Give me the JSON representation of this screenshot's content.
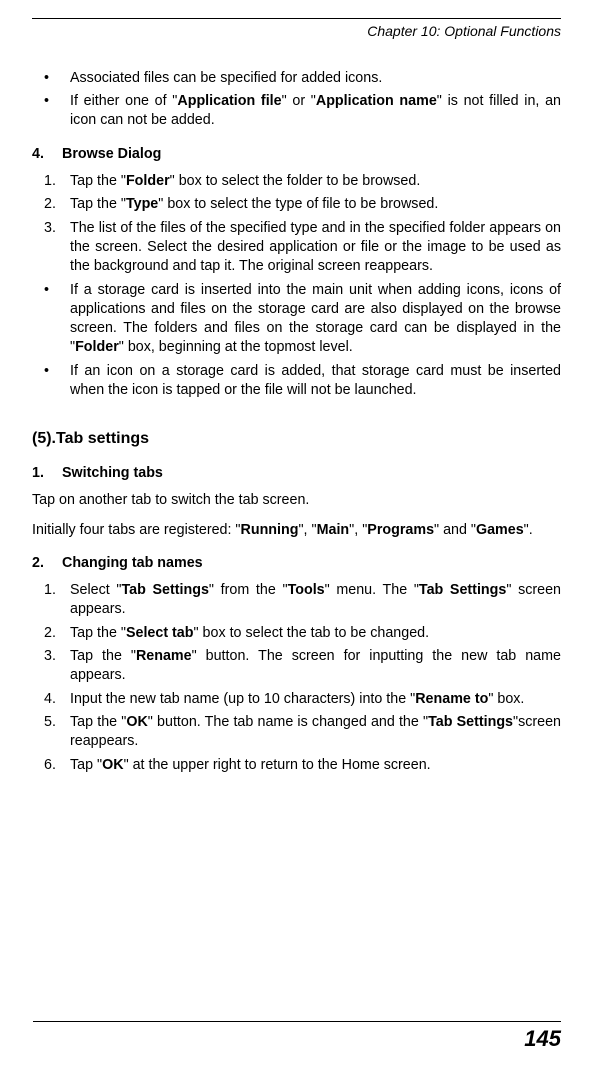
{
  "chapter_header": "Chapter 10: Optional Functions",
  "page_number": "145",
  "top_bullets": [
    {
      "marker": "•",
      "html": "Associated files can be specified for added icons."
    },
    {
      "marker": "•",
      "html": "If either one of \"<b>Application file</b>\" or \"<b>Application name</b>\" is not filled in, an icon can not be added."
    }
  ],
  "browse_heading_num": "4.",
  "browse_heading_label": "Browse Dialog",
  "browse_items": [
    {
      "marker": "1.",
      "html": "Tap the \"<b>Folder</b>\" box to select the folder to be browsed."
    },
    {
      "marker": "2.",
      "html": "Tap the \"<b>Type</b>\" box to select the type of file to be browsed."
    },
    {
      "marker": "3.",
      "html": "The list of the files of the specified type and in the specified folder appears on the screen. Select the desired application or file or the image to be used as the background and tap it. The original screen reappears."
    },
    {
      "marker": "•",
      "html": "If a storage card is inserted into the main unit when adding icons, icons of applications and files on the storage card are also displayed on the browse screen. The folders and files on the storage card can be displayed in the \"<b>Folder</b>\" box, beginning at the topmost level."
    },
    {
      "marker": "•",
      "html": "If an icon on a storage card is added, that storage card must be inserted when the icon is tapped or the file will not be launched."
    }
  ],
  "tab_settings_heading": "(5).Tab settings",
  "switching_heading_num": "1.",
  "switching_heading_label": "Switching tabs",
  "switching_para1": "Tap on another tab to switch the tab screen.",
  "switching_para2_html": "Initially four tabs are registered: \"<b>Running</b>\", \"<b>Main</b>\", \"<b>Programs</b>\" and \"<b>Games</b>\".",
  "changing_heading_num": "2.",
  "changing_heading_label": "Changing tab names",
  "changing_items": [
    {
      "marker": "1.",
      "html": "Select \"<b>Tab Settings</b>\" from the \"<b>Tools</b>\" menu. The \"<b>Tab Settings</b>\" screen appears."
    },
    {
      "marker": "2.",
      "html": "Tap the \"<b>Select tab</b>\" box to select the tab to be changed."
    },
    {
      "marker": "3.",
      "html": "Tap the \"<b>Rename</b>\" button. The screen for inputting the new tab name appears."
    },
    {
      "marker": "4.",
      "html": "Input the new tab name (up to 10 characters) into the \"<b>Rename to</b>\" box."
    },
    {
      "marker": "5.",
      "html": "Tap the \"<b>OK</b>\" button. The tab name is changed and the \"<b>Tab Settings</b>\"screen reappears."
    },
    {
      "marker": "6.",
      "html": "Tap \"<b>OK</b>\" at the upper right to return to the Home screen."
    }
  ]
}
